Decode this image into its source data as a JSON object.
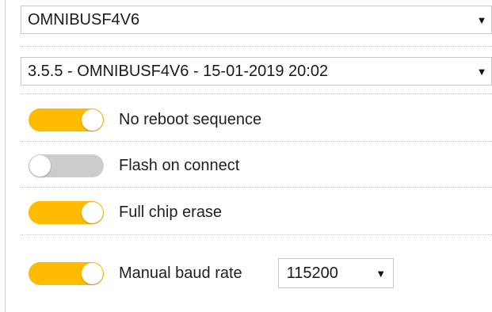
{
  "board_select": {
    "value": "OMNIBUSF4V6",
    "icon": "caret-down-icon"
  },
  "firmware_select": {
    "value": "3.5.5 - OMNIBUSF4V6 - 15-01-2019 20:02",
    "icon": "caret-down-icon"
  },
  "options": [
    {
      "label": "No reboot sequence",
      "enabled": true
    },
    {
      "label": "Flash on connect",
      "enabled": false
    },
    {
      "label": "Full chip erase",
      "enabled": true
    },
    {
      "label": "Manual baud rate",
      "enabled": true
    }
  ],
  "baud_select": {
    "value": "115200",
    "icon": "caret-down-icon"
  },
  "colors": {
    "toggle_on": "#ffbb00",
    "toggle_off": "#cccccc",
    "border": "#c9c9c9"
  }
}
